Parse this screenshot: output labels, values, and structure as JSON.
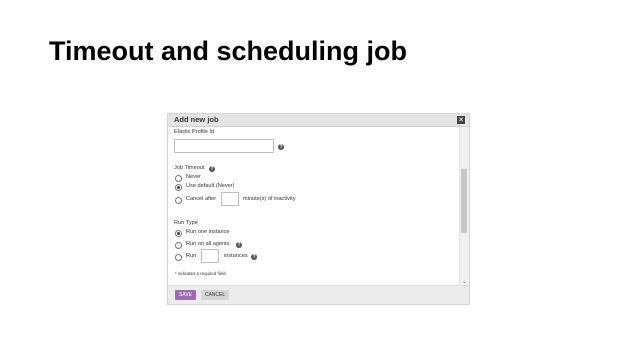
{
  "slide": {
    "title": "Timeout and scheduling job"
  },
  "dialog": {
    "title": "Add new job",
    "close_glyph": "✕",
    "elastic_profile": {
      "label": "Elastic Profile Id",
      "value": "",
      "help_glyph": "?"
    },
    "job_timeout": {
      "label": "Job Timeout",
      "help_glyph": "?",
      "options": [
        {
          "label": "Never",
          "checked": false
        },
        {
          "label": "Use default (Never)",
          "checked": true
        },
        {
          "label": "Cancel after",
          "checked": false
        }
      ],
      "cancel_after_value": "",
      "cancel_after_suffix": "minute(s) of inactivity"
    },
    "run_type": {
      "label": "Run Type",
      "options": [
        {
          "label": "Run one instance",
          "checked": true
        },
        {
          "label": "Run on all agents",
          "checked": false
        },
        {
          "label": "Run",
          "checked": false
        }
      ],
      "run_all_help_glyph": "?",
      "instances_value": "",
      "instances_suffix": "instances",
      "instances_help_glyph": "?"
    },
    "required_note": {
      "star": "*",
      "text": "indicates a required field"
    },
    "footer": {
      "save_label": "SAVE",
      "cancel_label": "CANCEL"
    },
    "scroll_down_glyph": "⌄"
  }
}
